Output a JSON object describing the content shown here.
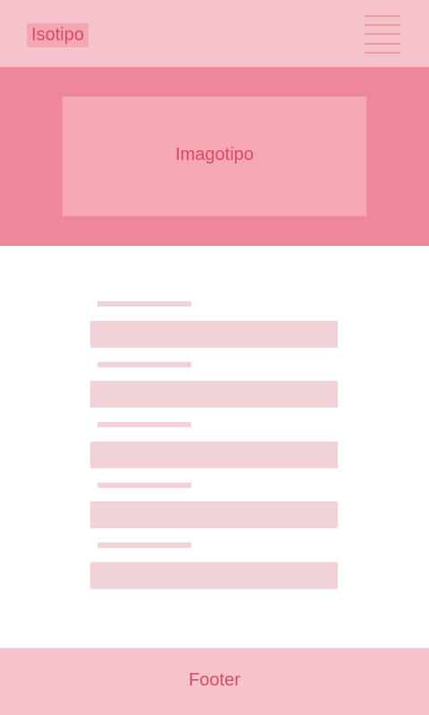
{
  "header": {
    "logo_text": "Isotipo",
    "menu_icon": "hamburger-menu-icon"
  },
  "hero": {
    "title": "Imagotipo"
  },
  "form": {
    "field_count": 5
  },
  "footer": {
    "text": "Footer"
  },
  "colors": {
    "header_bg": "#f7c3ca",
    "hero_bg": "#ed8799",
    "hero_card_bg": "#f6a8b2",
    "accent_text": "#d94a68",
    "placeholder_block": "#f2d3d8",
    "menu_lines": "#f098a7"
  }
}
